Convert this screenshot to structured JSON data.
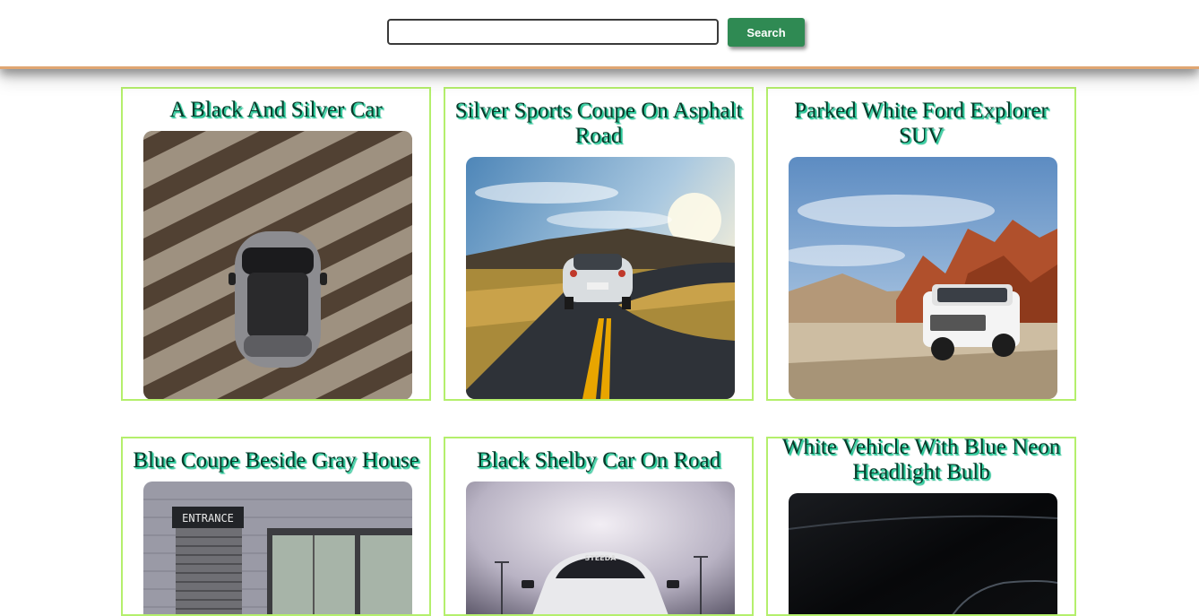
{
  "search": {
    "value": "",
    "placeholder": "",
    "button_label": "Search",
    "button_color": "#2f8a53"
  },
  "colors": {
    "card_border": "#b4ef6c",
    "header_border": "#e0a672",
    "title_text": "#0a3a2a",
    "title_shadow": "#2cd6a4"
  },
  "cards": [
    {
      "title": "A Black And Silver Car",
      "image": "top-down-car-striped-shadow-photo"
    },
    {
      "title": "Silver Sports Coupe On Asphalt Road",
      "image": "sports-coupe-winding-road-sunset-photo"
    },
    {
      "title": "Parked White Ford Explorer SUV",
      "image": "white-suv-desert-rocks-photo"
    },
    {
      "title": "Blue Coupe Beside Gray House",
      "image": "entrance-building-facade-photo"
    },
    {
      "title": "Black Shelby Car On Road",
      "image": "shelby-car-cloudy-sky-photo"
    },
    {
      "title": "White Vehicle With Blue Neon Headlight Bulb",
      "image": "dark-vehicle-closeup-photo"
    }
  ]
}
